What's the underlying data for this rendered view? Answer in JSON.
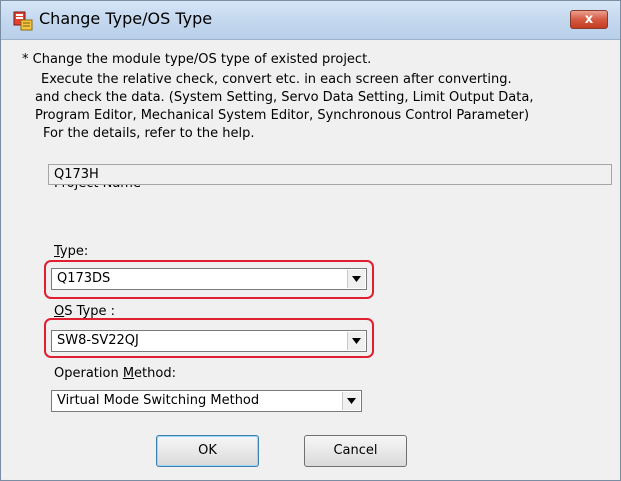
{
  "window": {
    "title": "Change Type/OS Type",
    "close_label": "x"
  },
  "description": {
    "line1": "* Change the module type/OS type of existed project.",
    "line2": "Execute the relative check, convert etc. in each screen after converting.",
    "line3": "and check the data. (System Setting, Servo Data Setting, Limit Output Data,",
    "line4": "Program Editor, Mechanical System Editor, Synchronous Control Parameter)",
    "line5": "For the details, refer to the help."
  },
  "project_name": {
    "label": "Project Name",
    "value": "Q173H"
  },
  "type": {
    "label_accel": "T",
    "label_rest": "ype:",
    "value": "Q173DS"
  },
  "os_type": {
    "label_accel": "O",
    "label_rest": "S Type :",
    "value": "SW8-SV22QJ"
  },
  "operation_method": {
    "label_prefix": "Operation ",
    "label_accel": "M",
    "label_rest": "ethod:",
    "value": "Virtual Mode Switching Method"
  },
  "buttons": {
    "ok": "OK",
    "cancel": "Cancel"
  },
  "colors": {
    "highlight": "#e02030",
    "close_button": "#c33d22"
  }
}
